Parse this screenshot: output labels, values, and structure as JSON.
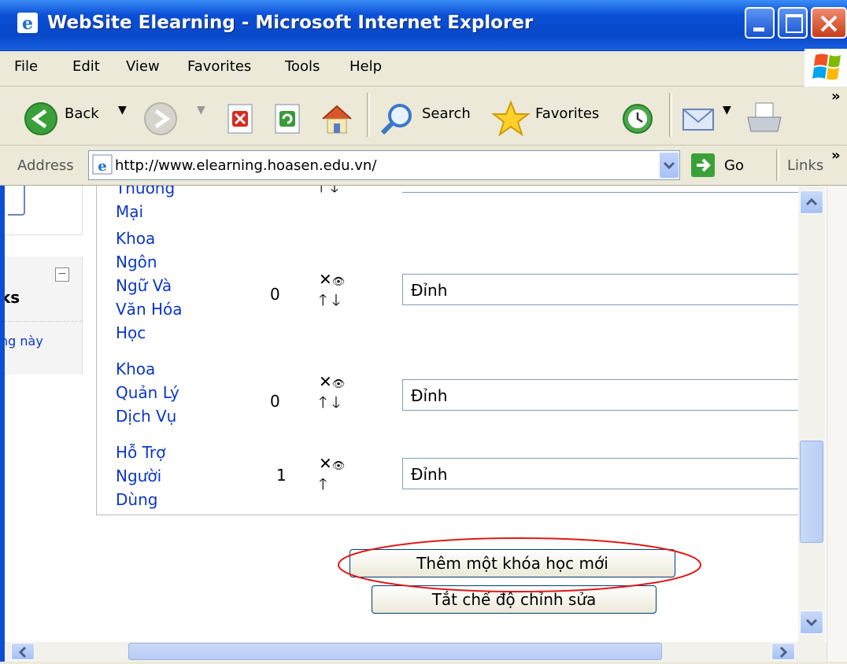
{
  "window": {
    "title": "WebSite Elearning - Microsoft Internet Explorer"
  },
  "menu": {
    "items": [
      "File",
      "Edit",
      "View",
      "Favorites",
      "Tools",
      "Help"
    ]
  },
  "toolbar": {
    "back_label": "Back",
    "search_label": "Search",
    "favorites_label": "Favorites",
    "overflow": "»"
  },
  "address": {
    "label": "Address",
    "url": "http://www.elearning.hoasen.edu.vn/",
    "go_label": "Go",
    "links_label": "Links",
    "links_overflow": "»"
  },
  "sidebar": {
    "block_title_fragment": "ks",
    "block_text_fragment": "ng này",
    "collapse_symbol": "−"
  },
  "courses": [
    {
      "name_lines": [
        "Thương",
        "Mại"
      ],
      "count": "",
      "position": ""
    },
    {
      "name_lines": [
        "Khoa",
        "Ngôn",
        "Ngữ Và",
        "Văn Hóa",
        "Học"
      ],
      "count": "0",
      "position": "Đỉnh"
    },
    {
      "name_lines": [
        "Khoa",
        "Quản Lý",
        "Dịch Vụ"
      ],
      "count": "0",
      "position": "Đỉnh"
    },
    {
      "name_lines": [
        "Hỗ Trợ",
        "Người",
        "Dùng"
      ],
      "count": "1",
      "position": "Đỉnh"
    }
  ],
  "actions": {
    "delete": "✕",
    "visible": "👁",
    "up": "🡑",
    "down": "🡓"
  },
  "buttons": {
    "add_course": "Thêm một khóa học mới",
    "turn_off_editing": "Tắt chế độ chỉnh sửa"
  },
  "colors": {
    "titlebar": "#0a4fd6",
    "link": "#0b37c8",
    "highlight_ellipse": "#e01818",
    "chrome": "#ece9d8"
  }
}
